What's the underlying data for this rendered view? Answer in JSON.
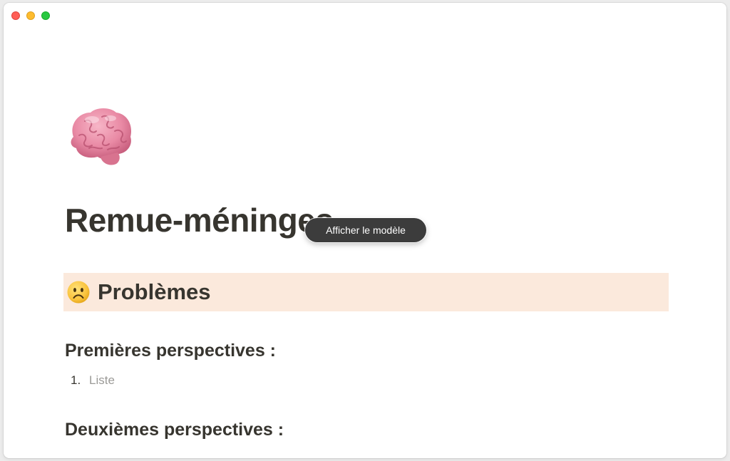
{
  "window": {
    "controls": [
      "close",
      "minimize",
      "zoom"
    ]
  },
  "page": {
    "icon": "brain-emoji",
    "title": "Remue-méninges"
  },
  "tooltip": {
    "label": "Afficher le modèle"
  },
  "callout": {
    "emoji": "frowning-face-emoji",
    "title": "Problèmes",
    "background": "#fbe9dc"
  },
  "sections": [
    {
      "heading": "Premières perspectives :",
      "items": [
        {
          "number": "1.",
          "text": "Liste"
        }
      ]
    },
    {
      "heading": "Deuxièmes perspectives :"
    }
  ],
  "colors": {
    "text": "#37352f",
    "placeholder": "#9b9a97",
    "tooltip_bg": "#3c3c3c"
  }
}
